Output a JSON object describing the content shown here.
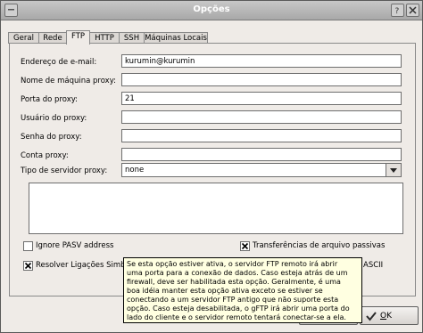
{
  "window": {
    "title": "Opções"
  },
  "tabs": [
    "Geral",
    "Rede",
    "FTP",
    "HTTP",
    "SSH",
    "Máquinas Locais"
  ],
  "form": {
    "email_label": "Endereço de e-mail:",
    "email_value": "kurumin@kurumin",
    "proxy_host_label": "Nome de máquina proxy:",
    "proxy_host_value": "",
    "proxy_port_label": "Porta do proxy:",
    "proxy_port_value": "21",
    "proxy_user_label": "Usuário do proxy:",
    "proxy_user_value": "",
    "proxy_pass_label": "Senha do proxy:",
    "proxy_pass_value": "",
    "proxy_account_label": "Conta proxy:",
    "proxy_account_value": "",
    "proxy_type_label": "Tipo de servidor proxy:",
    "proxy_type_value": "none"
  },
  "options": {
    "ignore_pasv_label": "Ignore PASV address",
    "ignore_pasv_checked": false,
    "passive_label": "Transferências de arquivo passivas",
    "passive_checked": true,
    "resolve_label": "Resolver Ligações Simb",
    "resolve_checked": true,
    "ascii_label": "ASCII"
  },
  "tooltip": {
    "lines": [
      "Se esta opção estiver ativa, o servidor FTP remoto irá abrir",
      "uma porta para a conexão de dados. Caso esteja atrás de um",
      "firewall, deve ser habilitada esta opção. Geralmente, é uma",
      "boa idéia manter esta opção ativa exceto se estiver se",
      "conectando a um servidor FTP antigo que não suporte esta",
      "opção. Caso esteja desabilitada, o gFTP irá abrir uma porta do",
      "lado do cliente e o servidor remoto tentará conectar-se a ela."
    ]
  },
  "buttons": {
    "ok_prefix": "",
    "ok_underlined": "O",
    "ok_rest": "K"
  }
}
